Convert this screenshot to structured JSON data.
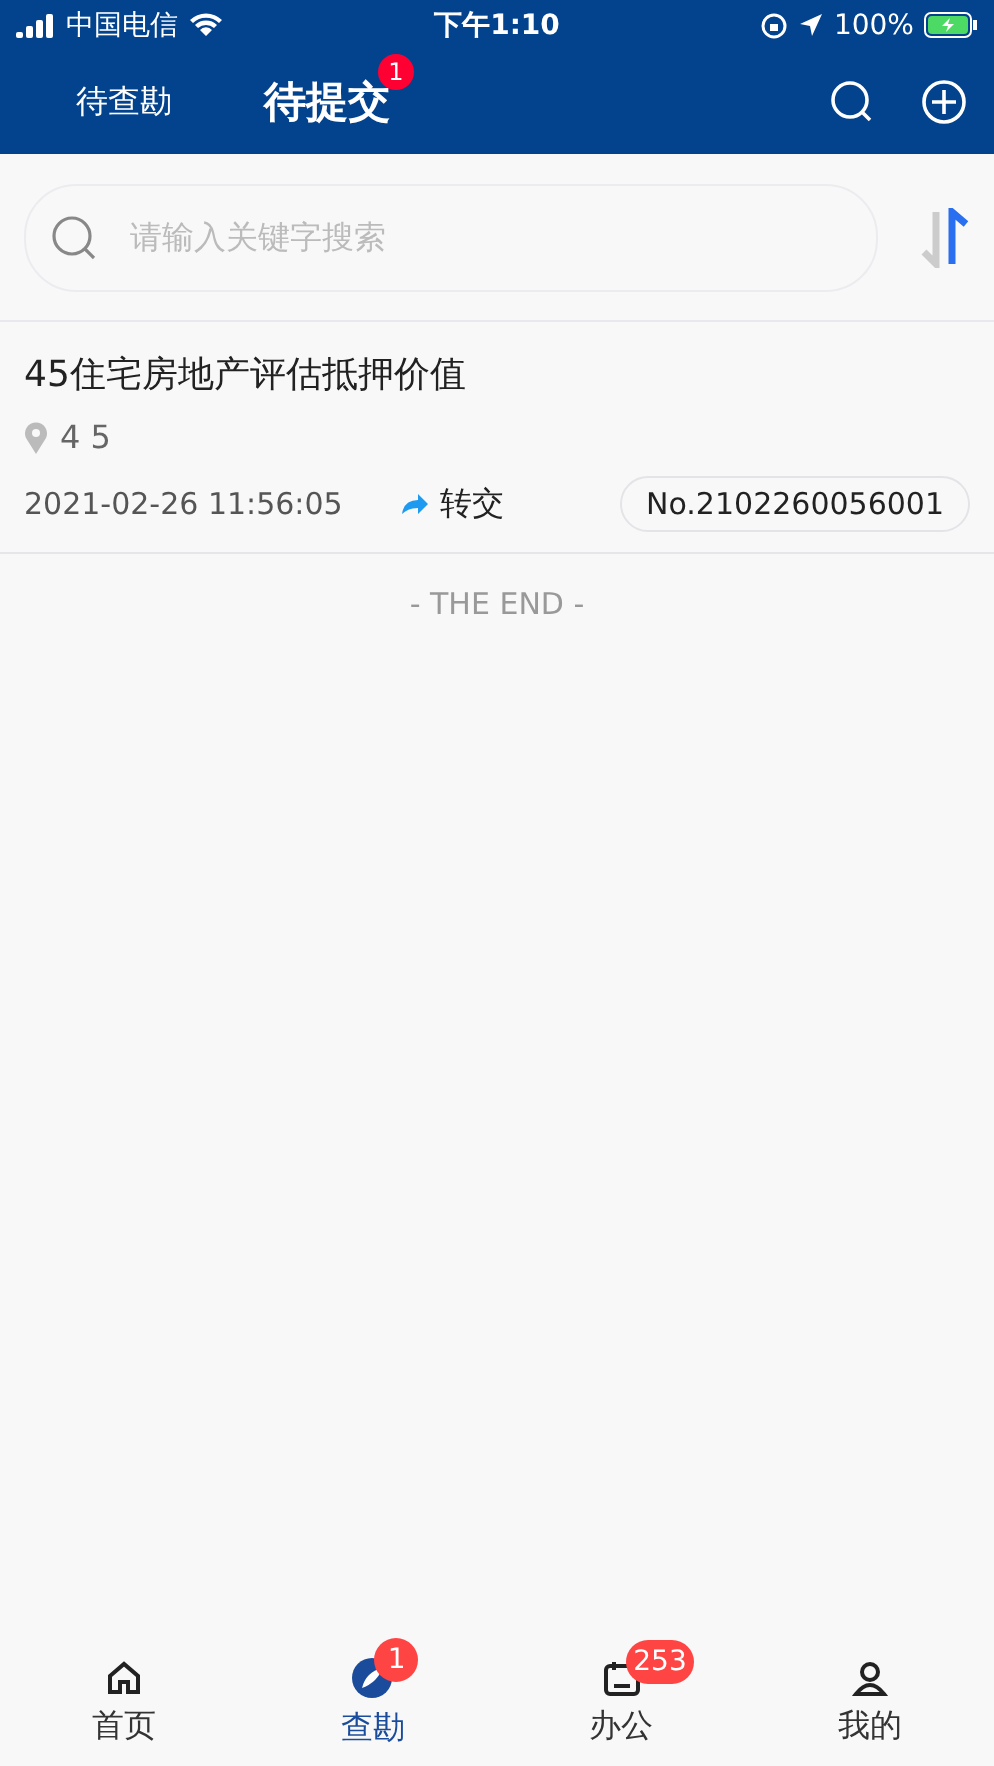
{
  "status_bar": {
    "carrier": "中国电信",
    "time": "下午1:10",
    "battery": "100%"
  },
  "header": {
    "tabs": [
      {
        "label": "待查勘",
        "selected": false
      },
      {
        "label": "待提交",
        "selected": true,
        "badge": "1"
      }
    ]
  },
  "search": {
    "placeholder": "请输入关键字搜索"
  },
  "records": [
    {
      "title": "45住宅房地产评估抵押价值",
      "location": "4 5",
      "datetime": "2021-02-26 11:56:05",
      "action": "转交",
      "number": "No.2102260056001"
    }
  ],
  "end_text": "- THE END -",
  "bottom_nav": [
    {
      "kind": "home",
      "label": "首页",
      "selected": false
    },
    {
      "kind": "survey",
      "label": "查勘",
      "selected": true,
      "badge": "1"
    },
    {
      "kind": "office",
      "label": "办公",
      "selected": false,
      "badge": "253"
    },
    {
      "kind": "me",
      "label": "我的",
      "selected": false
    }
  ]
}
